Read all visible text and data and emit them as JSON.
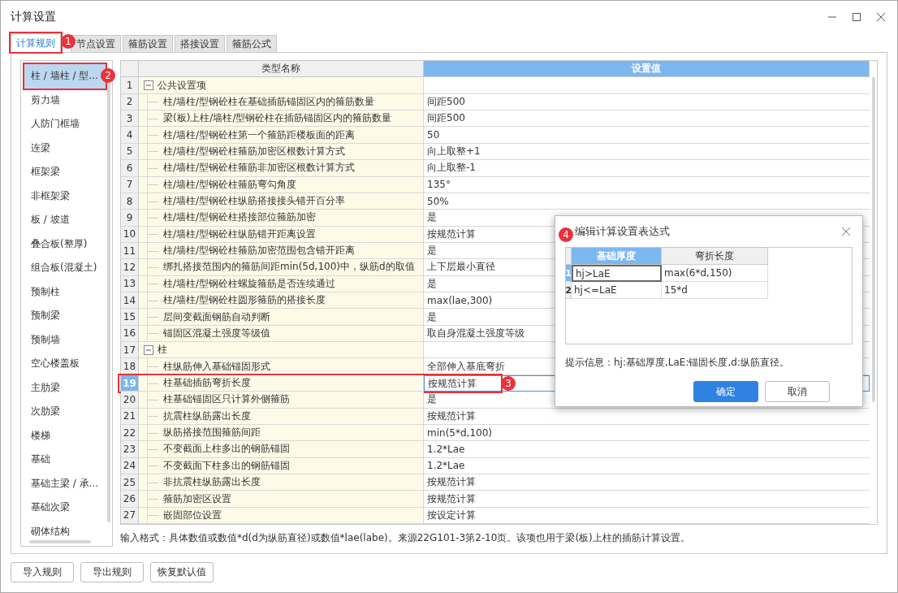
{
  "window": {
    "title": "计算设置"
  },
  "tabs": [
    {
      "label": "计算规则",
      "selected": true,
      "callout": "1"
    },
    {
      "label": "节点设置",
      "selected": false
    },
    {
      "label": "箍筋设置",
      "selected": false
    },
    {
      "label": "搭接设置",
      "selected": false
    },
    {
      "label": "箍筋公式",
      "selected": false
    }
  ],
  "sidebar": {
    "items": [
      {
        "label": "柱 / 墙柱 / 型...",
        "selected": true,
        "callout": "2"
      },
      {
        "label": "剪力墙",
        "selected": false
      },
      {
        "label": "人防门框墙",
        "selected": false
      },
      {
        "label": "连梁",
        "selected": false
      },
      {
        "label": "框架梁",
        "selected": false
      },
      {
        "label": "非框架梁",
        "selected": false
      },
      {
        "label": "板 / 坡道",
        "selected": false
      },
      {
        "label": "叠合板(整厚)",
        "selected": false
      },
      {
        "label": "组合板(混凝土)",
        "selected": false
      },
      {
        "label": "预制柱",
        "selected": false
      },
      {
        "label": "预制梁",
        "selected": false
      },
      {
        "label": "预制墙",
        "selected": false
      },
      {
        "label": "空心楼盖板",
        "selected": false
      },
      {
        "label": "主肋梁",
        "selected": false
      },
      {
        "label": "次肋梁",
        "selected": false
      },
      {
        "label": "楼梯",
        "selected": false
      },
      {
        "label": "基础",
        "selected": false
      },
      {
        "label": "基础主梁 / 承...",
        "selected": false
      },
      {
        "label": "基础次梁",
        "selected": false
      },
      {
        "label": "砌体结构",
        "selected": false
      }
    ]
  },
  "table": {
    "columns": [
      {
        "label": "类型名称",
        "selected": false
      },
      {
        "label": "设置值",
        "selected": true
      }
    ],
    "groups": [
      {
        "no": "1",
        "label": "公共设置项",
        "expanded": true,
        "children": [
          {
            "no": "2",
            "name": "柱/墙柱/型钢砼柱在基础插筋锚固区内的箍筋数量",
            "value": "间距500",
            "selected": false
          },
          {
            "no": "3",
            "name": "梁(板)上柱/墙柱/型钢砼柱在插筋锚固区内的箍筋数量",
            "value": "间距500",
            "selected": false
          },
          {
            "no": "4",
            "name": "柱/墙柱/型钢砼柱第一个箍筋距楼板面的距离",
            "value": "50",
            "selected": false
          },
          {
            "no": "5",
            "name": "柱/墙柱/型钢砼柱箍筋加密区根数计算方式",
            "value": "向上取整+1",
            "selected": false
          },
          {
            "no": "6",
            "name": "柱/墙柱/型钢砼柱箍筋非加密区根数计算方式",
            "value": "向上取整-1",
            "selected": false
          },
          {
            "no": "7",
            "name": "柱/墙柱/型钢砼柱箍筋弯勾角度",
            "value": "135°",
            "selected": false
          },
          {
            "no": "8",
            "name": "柱/墙柱/型钢砼柱纵筋搭接接头错开百分率",
            "value": "50%",
            "selected": false
          },
          {
            "no": "9",
            "name": "柱/墙柱/型钢砼柱搭接部位箍筋加密",
            "value": "是",
            "selected": false
          },
          {
            "no": "10",
            "name": "柱/墙柱/型钢砼柱纵筋错开距离设置",
            "value": "按规范计算",
            "selected": false
          },
          {
            "no": "11",
            "name": "柱/墙柱/型钢砼柱箍筋加密范围包含错开距离",
            "value": "是",
            "selected": false
          },
          {
            "no": "12",
            "name": "绑扎搭接范围内的箍筋间距min(5d,100)中，纵筋d的取值",
            "value": "上下层最小直径",
            "selected": false
          },
          {
            "no": "13",
            "name": "柱/墙柱/型钢砼柱螺旋箍筋是否连续通过",
            "value": "是",
            "selected": false
          },
          {
            "no": "14",
            "name": "柱/墙柱/型钢砼柱圆形箍筋的搭接长度",
            "value": "max(lae,300)",
            "selected": false
          },
          {
            "no": "15",
            "name": "层间变截面钢筋自动判断",
            "value": "是",
            "selected": false
          },
          {
            "no": "16",
            "name": "锚固区混凝土强度等级值",
            "value": "取自身混凝土强度等级",
            "selected": false
          }
        ]
      },
      {
        "no": "17",
        "label": "柱",
        "expanded": true,
        "children": [
          {
            "no": "18",
            "name": "柱纵筋伸入基础锚固形式",
            "value": "全部伸入基底弯折",
            "selected": false
          },
          {
            "no": "19",
            "name": "柱基础插筋弯折长度",
            "value": "按规范计算",
            "selected": true,
            "callout": "3"
          },
          {
            "no": "20",
            "name": "柱基础锚固区只计算外侧箍筋",
            "value": "是",
            "selected": false
          },
          {
            "no": "21",
            "name": "抗震柱纵筋露出长度",
            "value": "按规范计算",
            "selected": false
          },
          {
            "no": "22",
            "name": "纵筋搭接范围箍筋间距",
            "value": "min(5*d,100)",
            "selected": false
          },
          {
            "no": "23",
            "name": "不变截面上柱多出的钢筋锚固",
            "value": "1.2*Lae",
            "selected": false
          },
          {
            "no": "24",
            "name": "不变截面下柱多出的钢筋锚固",
            "value": "1.2*Lae",
            "selected": false
          },
          {
            "no": "25",
            "name": "非抗震柱纵筋露出长度",
            "value": "按规范计算",
            "selected": false
          },
          {
            "no": "26",
            "name": "箍筋加密区设置",
            "value": "按规范计算",
            "selected": false
          },
          {
            "no": "27",
            "name": "嵌固部位设置",
            "value": "按设定计算",
            "selected": false
          }
        ]
      }
    ]
  },
  "hint": "输入格式：具体数值或数值*d(d为纵筋直径)或数值*lae(labe)。来源22G101-3第2-10页。该项也用于梁(板)上柱的插筋计算设置。",
  "buttons": [
    "导入规则",
    "导出规则",
    "恢复默认值"
  ],
  "dialog": {
    "title": "编辑计算设置表达式",
    "callout": "4",
    "columns": [
      {
        "label": "基础厚度",
        "selected": true
      },
      {
        "label": "弯折长度",
        "selected": false
      }
    ],
    "rows": [
      {
        "no": "1",
        "selected": true,
        "cells": [
          "hj>LaE",
          "max(6*d,150)"
        ]
      },
      {
        "no": "2",
        "selected": false,
        "cells": [
          "hj<=LaE",
          "15*d"
        ]
      }
    ],
    "hint": "提示信息：hj:基础厚度,LaE:锚固长度,d:纵筋直径。",
    "buttons": [
      {
        "label": "确定",
        "kind": "primary"
      },
      {
        "label": "取消",
        "kind": "default"
      }
    ]
  }
}
